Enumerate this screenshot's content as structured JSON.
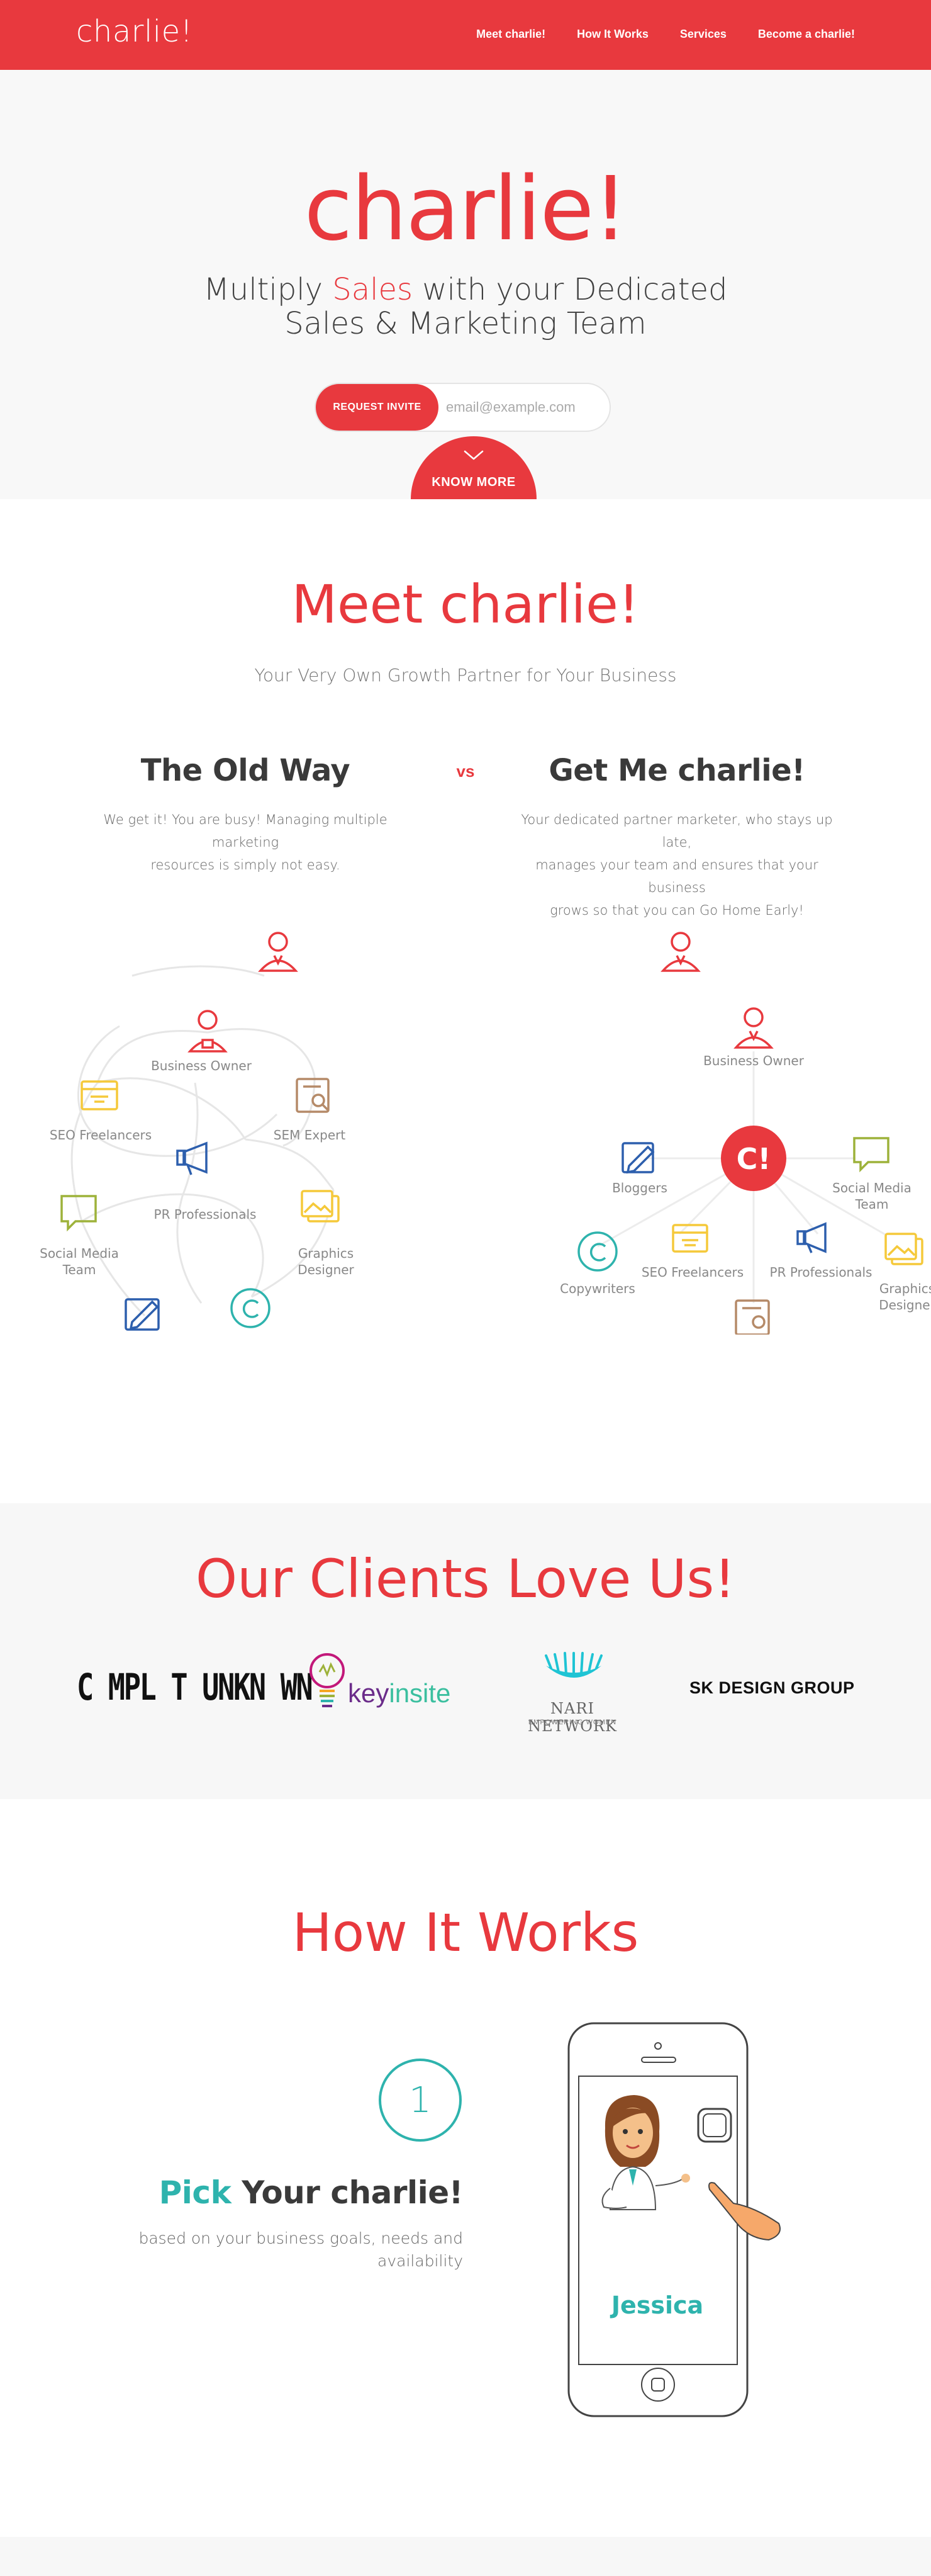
{
  "nav": {
    "logo": "charlie!",
    "links": [
      "Meet charlie!",
      "How It Works",
      "Services",
      "Become a charlie!"
    ]
  },
  "hero": {
    "title": "charlie!",
    "subtitle_pre": "Multiply ",
    "subtitle_highlight": "Sales",
    "subtitle_post": " with your Dedicated",
    "subtitle_line2": "Sales & Marketing Team",
    "invite_button": "REQUEST INVITE",
    "email_placeholder": "email@example.com",
    "know_more": "KNOW MORE"
  },
  "meet": {
    "title": "Meet charlie!",
    "subtitle": "Your Very Own Growth Partner for Your Business",
    "vs": "vs",
    "old_way": {
      "title": "The Old Way",
      "text_line1": "We get it! You are busy! Managing multiple marketing",
      "text_line2": "resources is simply not easy."
    },
    "new_way": {
      "title": "Get Me charlie!",
      "text_line1": "Your dedicated partner marketer, who stays up late,",
      "text_line2": "manages your team and ensures that your business",
      "text_line3": "grows so that you can Go Home Early!"
    },
    "old_diagram": {
      "business_owner": "Business Owner",
      "seo": "SEO Freelancers",
      "sem": "SEM Expert",
      "pr": "PR Professionals",
      "social_line1": "Social Media",
      "social_line2": "Team",
      "graphics_line1": "Graphics",
      "graphics_line2": "Designer"
    },
    "new_diagram": {
      "business_owner": "Business Owner",
      "center": "C!",
      "bloggers": "Bloggers",
      "social_line1": "Social Media",
      "social_line2": "Team",
      "copywriters": "Copywriters",
      "seo": "SEO Freelancers",
      "pr": "PR Professionals",
      "graphics_line1": "Graphics",
      "graphics_line2": "Designer"
    }
  },
  "clients": {
    "title": "Our Clients Love Us!",
    "logo1": "C MPL T UNKN WN",
    "logo2_key": "key",
    "logo2_insite": "insite",
    "logo3": "NARI NETWORK",
    "logo3_sub": "EMPOWERING WOMEN",
    "logo4": "SK DESIGN GROUP"
  },
  "how": {
    "title": "How It Works",
    "step_number": "1",
    "step_pick": "Pick",
    "step_rest": " Your charlie!",
    "step_text_line1": "based on your business goals, needs and",
    "step_text_line2": "availability",
    "phone_name": "Jessica"
  },
  "colors": {
    "brand_red": "#e8393e",
    "teal": "#2eb3ad",
    "yellow": "#f5c93a",
    "brown": "#b58a68",
    "blue": "#2d5fad",
    "olive": "#9db23a"
  }
}
